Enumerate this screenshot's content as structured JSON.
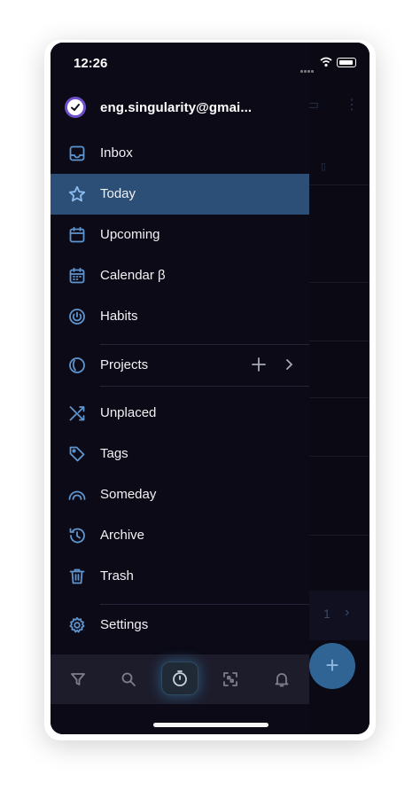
{
  "status_bar": {
    "time": "12:26"
  },
  "account": {
    "email": "eng.singularity@gmai..."
  },
  "menu": {
    "inbox": "Inbox",
    "today": "Today",
    "upcoming": "Upcoming",
    "calendar": "Calendar β",
    "habits": "Habits",
    "projects": "Projects",
    "unplaced": "Unplaced",
    "tags": "Tags",
    "someday": "Someday",
    "archive": "Archive",
    "trash": "Trash",
    "settings": "Settings"
  },
  "selected_item": "Today",
  "icons": {
    "inbox": "inbox-icon",
    "today": "star-icon",
    "upcoming": "calendar-icon",
    "calendar": "calendar-grid-icon",
    "habits": "habits-icon",
    "projects": "projects-icon",
    "unplaced": "shuffle-icon",
    "tags": "tag-icon",
    "someday": "someday-icon",
    "archive": "history-icon",
    "trash": "trash-icon",
    "settings": "gear-icon"
  },
  "toolbar": [
    "filter-icon",
    "search-icon",
    "timer-icon",
    "scan-icon",
    "bell-icon"
  ],
  "background": {
    "page_number": "1"
  },
  "colors": {
    "accent": "#2c4f77",
    "icon": "#5f95cf",
    "fab": "#2f6494",
    "background": "#0b0a16"
  }
}
